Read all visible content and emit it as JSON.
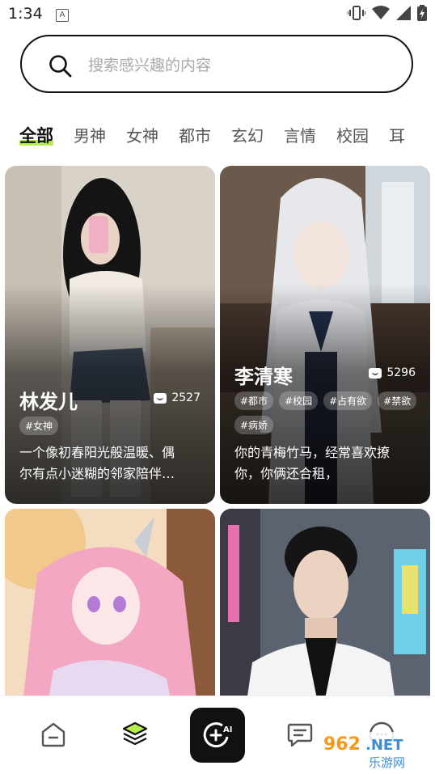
{
  "status_bar": {
    "time": "1:34"
  },
  "search": {
    "placeholder": "搜索感兴趣的内容"
  },
  "tabs": [
    {
      "label": "全部",
      "active": true
    },
    {
      "label": "男神"
    },
    {
      "label": "女神"
    },
    {
      "label": "都市"
    },
    {
      "label": "玄幻"
    },
    {
      "label": "言情"
    },
    {
      "label": "校园"
    },
    {
      "label": "耳"
    }
  ],
  "cards": [
    {
      "name": "林发儿",
      "count": "2527",
      "tags": [
        "#女神"
      ],
      "desc_line1": "一个像初春阳光般温暖、偶",
      "desc_line2": "尔有点小迷糊的邻家陪伴…"
    },
    {
      "name": "李清寒",
      "count": "5296",
      "tags": [
        "#都市",
        "#校园",
        "#占有欲",
        "#禁欲",
        "#病娇"
      ],
      "desc_line1": "你的青梅竹马，经常喜欢撩",
      "desc_line2": "你，你俩还合租，"
    },
    {
      "name": "",
      "count": ""
    },
    {
      "name": "",
      "count": ""
    }
  ],
  "bottom_nav": {
    "items": [
      "home-icon",
      "layers-icon",
      "ai-create-icon",
      "chat-icon",
      "profile-icon"
    ],
    "ai_label": "AI"
  },
  "watermark": {
    "text_top": "962.NET",
    "text_bottom": "乐游网"
  },
  "colors": {
    "accent": "#b8ee4a",
    "ai_button": "#111111"
  }
}
